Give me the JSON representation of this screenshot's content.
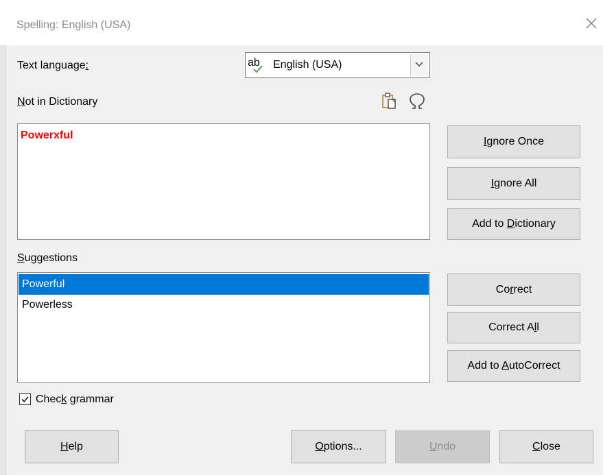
{
  "window": {
    "title": "Spelling: English (USA)",
    "close_icon": "close-icon"
  },
  "text_language": {
    "label_pre": "Text language",
    "label_key": ":",
    "selected": "English (USA)",
    "icon": "spellcheck-icon"
  },
  "not_in_dictionary": {
    "label_key": "N",
    "label_rest": "ot in Dictionary",
    "word": "Powerxful",
    "word_color": "#ff0000",
    "tools": [
      "paste-icon",
      "special-character-icon"
    ]
  },
  "suggestions": {
    "label_key": "S",
    "label_rest": "uggestions",
    "items": [
      {
        "text": "Powerful",
        "selected": true
      },
      {
        "text": "Powerless",
        "selected": false
      }
    ],
    "selection_color": "#0078d7"
  },
  "side_buttons": {
    "ignore_once": {
      "key": "I",
      "rest": "gnore Once"
    },
    "ignore_all": {
      "key": "I",
      "rest": "gnore All"
    },
    "add_to_dictionary": {
      "pre": "Add to ",
      "key": "D",
      "rest": "ictionary"
    },
    "correct": {
      "pre": "Co",
      "key": "r",
      "rest": "rect"
    },
    "correct_all": {
      "pre": "Correct A",
      "key": "l",
      "rest": "l"
    },
    "add_to_autocorrect": {
      "pre": "Add to ",
      "key": "A",
      "rest": "utoCorrect"
    }
  },
  "check_grammar": {
    "checked": true,
    "pre": "Chec",
    "key": "k",
    "rest": " grammar"
  },
  "bottom_buttons": {
    "help": {
      "key": "H",
      "rest": "elp"
    },
    "options": {
      "key": "O",
      "rest": "ptions..."
    },
    "undo": {
      "key": "U",
      "rest": "ndo",
      "disabled": true
    },
    "close": {
      "key": "C",
      "rest": "lose"
    }
  }
}
